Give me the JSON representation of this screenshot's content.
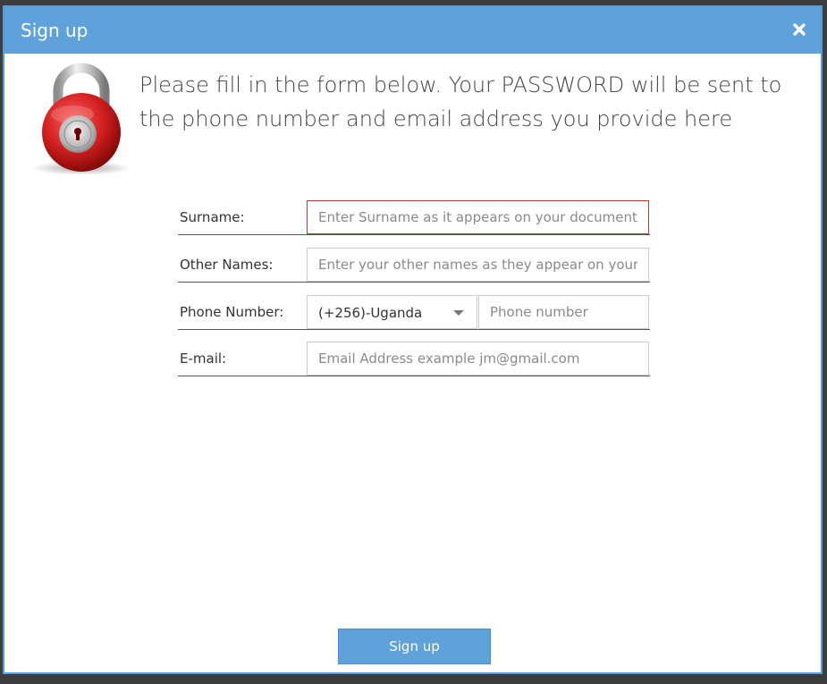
{
  "dialog": {
    "title": "Sign up",
    "close_icon": "close-icon"
  },
  "intro": {
    "lock_icon": "padlock-icon",
    "text": "Please fill in the form below. Your PASSWORD will be sent to the phone number and email address you provide here"
  },
  "form": {
    "surname": {
      "label": "Surname:",
      "placeholder": "Enter Surname as it appears on your documents",
      "value": ""
    },
    "other_names": {
      "label": "Other Names:",
      "placeholder": "Enter your other names as they appear on your documents",
      "value": ""
    },
    "phone": {
      "label": "Phone Number:",
      "country_selected": "(+256)-Uganda",
      "placeholder": "Phone number",
      "value": ""
    },
    "email": {
      "label": "E-mail:",
      "placeholder": "Email Address example jm@gmail.com",
      "value": ""
    }
  },
  "actions": {
    "signup_label": "Sign up"
  },
  "colors": {
    "accent": "#5fa2db",
    "focus_border": "#c0392b",
    "lock_red": "#d11f1f"
  }
}
